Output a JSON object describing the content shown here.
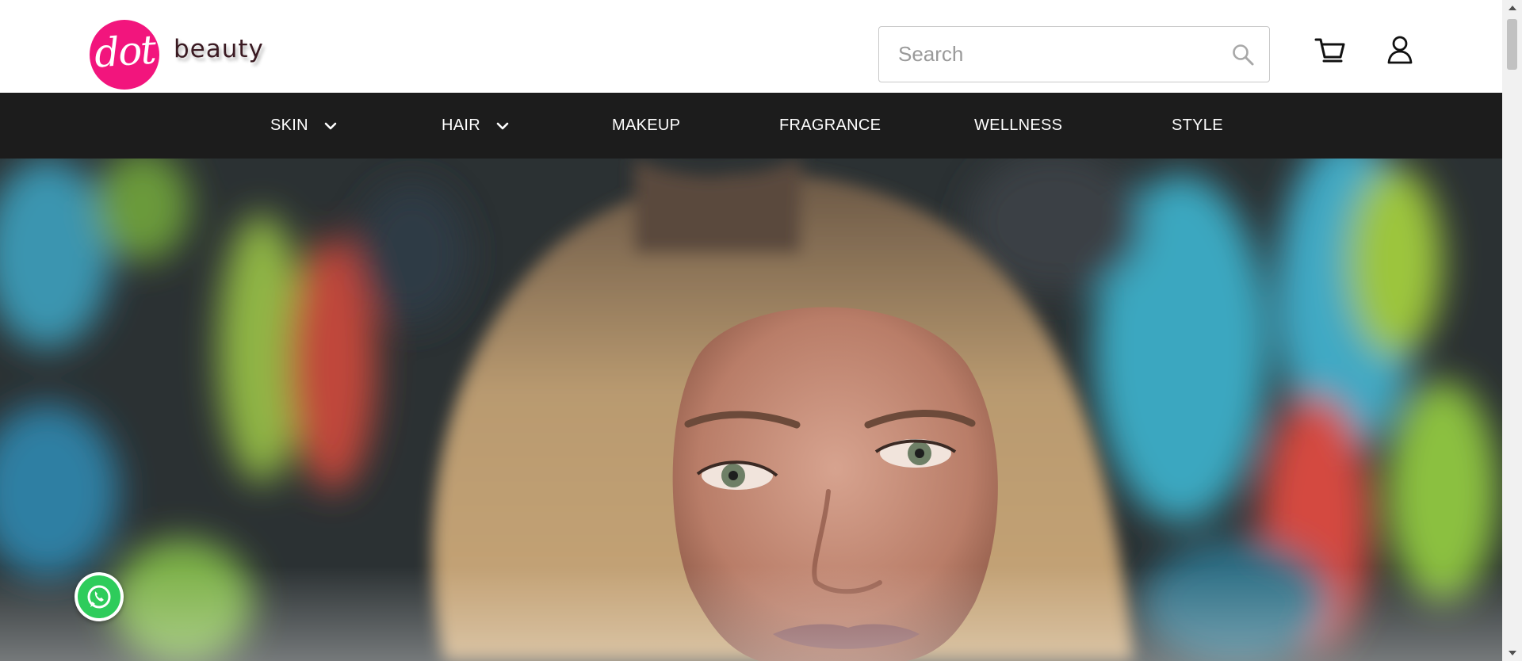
{
  "brand": {
    "logo_mark": "dot",
    "logo_word": "beauty",
    "accent_color": "#f2157d"
  },
  "search": {
    "placeholder": "Search",
    "value": "",
    "icon": "search-icon"
  },
  "header_icons": {
    "cart": "cart-icon",
    "account": "user-icon"
  },
  "nav": {
    "background": "#1c1c1c",
    "items": [
      {
        "label": "SKIN",
        "has_dropdown": true
      },
      {
        "label": "HAIR",
        "has_dropdown": true
      },
      {
        "label": "MAKEUP",
        "has_dropdown": false
      },
      {
        "label": "FRAGRANCE",
        "has_dropdown": false
      },
      {
        "label": "WELLNESS",
        "has_dropdown": false
      },
      {
        "label": "STYLE",
        "has_dropdown": false
      }
    ]
  },
  "hero": {
    "image": "portrait-photo"
  },
  "floating": {
    "whatsapp": "whatsapp-icon",
    "whatsapp_color": "#2ecc5b"
  }
}
